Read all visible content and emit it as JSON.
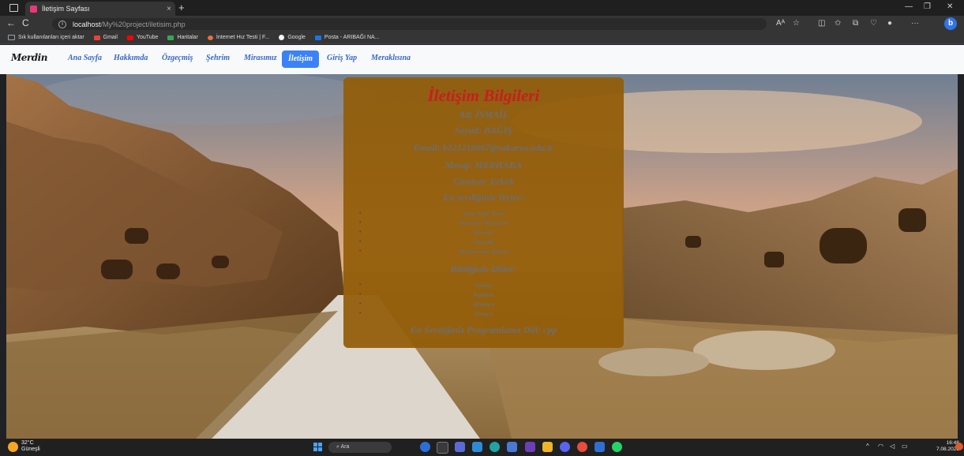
{
  "browser": {
    "tab_title": "İletişim Sayfası",
    "tab_close": "×",
    "new_tab": "+",
    "url_host": "localhost",
    "url_path": "/My%20project/iletisim.php",
    "back": "←",
    "refresh": "C",
    "bookmarks": [
      {
        "label": "Sık kullanılanları içeri aktar",
        "color": "#9aa0a6"
      },
      {
        "label": "Gmail",
        "color": "#ea4335"
      },
      {
        "label": "YouTube",
        "color": "#ff0000"
      },
      {
        "label": "Haritalar",
        "color": "#34a853"
      },
      {
        "label": "İnternet Hız Testi | F...",
        "color": "#e8713c"
      },
      {
        "label": "Google",
        "color": "#f4f4f4"
      },
      {
        "label": "Posta - ARIBAĞI NA...",
        "color": "#1a73e8"
      }
    ]
  },
  "navbar": {
    "logo": "Merdin",
    "links": [
      "Ana Sayfa",
      "Hakkımda",
      "Özgeçmiş",
      "Şehrim",
      "Mirasımız",
      "İletişim",
      "Giriş Yap",
      "Meraklısına"
    ],
    "active": "İletişim"
  },
  "card": {
    "title": "İletişim Bilgileri",
    "ad": "Ad: İSMAİL",
    "soyad": "Soyad: BAĞIŞ",
    "email": "Email: b221210067@sakarya.edu.tr",
    "mesaj": "Mesaj: MERHABA",
    "cinsiyet": "Cinsiyet: Erkek",
    "places_heading": "En sevdiğiniz Yerler:",
    "places": [
      "Dara Antik Kenti",
      "Kasımiye Medresesi",
      "Beyazsu",
      "Ulucami",
      "Meryem Ana Kilisesi"
    ],
    "languages_heading": "Bildiğiniz Diller:",
    "languages": [
      "Türkçe",
      "İngilizce",
      "Almanca",
      "Arapça"
    ],
    "programming": "En Sevdiğiniz Programlama Dili: cpp"
  },
  "taskbar": {
    "temperature": "32°C",
    "weather": "Güneşli",
    "search": "Ara",
    "time": "16:48",
    "date": "7.08.2023"
  }
}
